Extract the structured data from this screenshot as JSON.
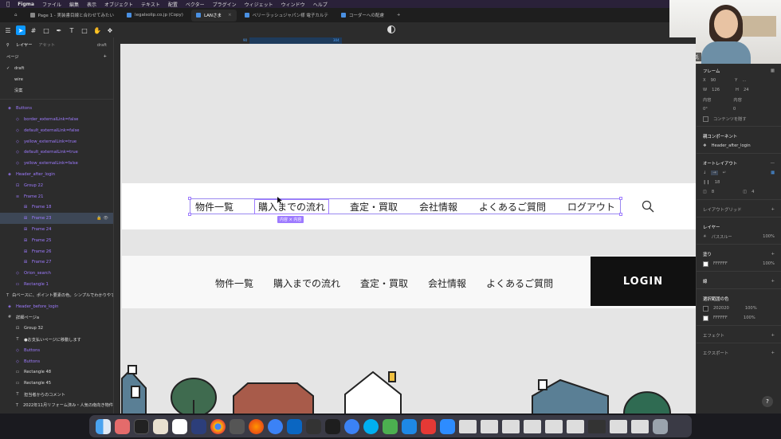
{
  "menubar": {
    "app_name": "Figma",
    "items": [
      "ファイル",
      "編集",
      "表示",
      "オブジェクト",
      "テキスト",
      "配置",
      "ベクター",
      "プラグイン",
      "ウィジェット",
      "ウィンドウ",
      "ヘルプ"
    ]
  },
  "tabs": [
    {
      "label": "Page 1 - 実装書目線と合わせてみたい"
    },
    {
      "label": "legalsolip.co.jp (Copy)"
    },
    {
      "label": "LANさま",
      "active": true
    },
    {
      "label": "ベリーラッシュジャパン様 電子カルテ"
    },
    {
      "label": "コーダーへの配慮"
    }
  ],
  "video": {
    "participant_name": "庄司 美雪氏"
  },
  "left_panel": {
    "tab_layers": "レイヤー",
    "tab_assets": "アセット",
    "page_label": "draft",
    "pages_title": "ページ",
    "pages": [
      {
        "label": "draft",
        "current": true
      },
      {
        "label": "wire"
      },
      {
        "label": "没案"
      }
    ],
    "layers": [
      {
        "label": "Buttons",
        "kind": "comp",
        "glyph": "◈",
        "indent": 0
      },
      {
        "label": "border_externalLink=false",
        "kind": "comp",
        "glyph": "◇",
        "indent": 1
      },
      {
        "label": "default_externalLink=false",
        "kind": "comp",
        "glyph": "◇",
        "indent": 1
      },
      {
        "label": "yellow_externalLink=true",
        "kind": "comp",
        "glyph": "◇",
        "indent": 1
      },
      {
        "label": "default_externalLink=true",
        "kind": "comp",
        "glyph": "◇",
        "indent": 1
      },
      {
        "label": "yellow_externalLink=false",
        "kind": "comp",
        "glyph": "◇",
        "indent": 1
      },
      {
        "label": "Header_after_login",
        "kind": "comp",
        "glyph": "◈",
        "indent": 0
      },
      {
        "label": "Group 22",
        "kind": "comp",
        "glyph": "⊡",
        "indent": 1
      },
      {
        "label": "Frame 21",
        "kind": "comp",
        "glyph": "≡",
        "indent": 1
      },
      {
        "label": "Frame 18",
        "kind": "comp",
        "glyph": "⊞",
        "indent": 2
      },
      {
        "label": "Frame 23",
        "kind": "comp",
        "glyph": "⊞",
        "indent": 2,
        "selected": true
      },
      {
        "label": "Frame 24",
        "kind": "comp",
        "glyph": "⊞",
        "indent": 2
      },
      {
        "label": "Frame 25",
        "kind": "comp",
        "glyph": "⊞",
        "indent": 2
      },
      {
        "label": "Frame 26",
        "kind": "comp",
        "glyph": "⊞",
        "indent": 2
      },
      {
        "label": "Frame 27",
        "kind": "comp",
        "glyph": "⊞",
        "indent": 2
      },
      {
        "label": "Orion_search",
        "kind": "comp",
        "glyph": "◇",
        "indent": 1
      },
      {
        "label": "Rectangle 1",
        "kind": "comp",
        "glyph": "▭",
        "indent": 1
      },
      {
        "label": "白ベースに、ポイント要素の色。シンプルでわかりやす",
        "kind": "text",
        "glyph": "T",
        "indent": 0
      },
      {
        "label": "Header_before_login",
        "kind": "comp",
        "glyph": "◈",
        "indent": 0
      },
      {
        "label": "詳細ページa",
        "kind": "frame",
        "glyph": "#",
        "indent": 0
      },
      {
        "label": "Group 32",
        "kind": "frame",
        "glyph": "⊡",
        "indent": 1
      },
      {
        "label": "●お支払いページに移動します",
        "kind": "text",
        "glyph": "T",
        "indent": 1
      },
      {
        "label": "Buttons",
        "kind": "comp",
        "glyph": "◇",
        "indent": 1
      },
      {
        "label": "Buttons",
        "kind": "comp",
        "glyph": "◇",
        "indent": 1
      },
      {
        "label": "Rectangle 48",
        "kind": "frame",
        "glyph": "▭",
        "indent": 1
      },
      {
        "label": "Rectangle 45",
        "kind": "frame",
        "glyph": "▭",
        "indent": 1
      },
      {
        "label": "担当者からのコメント",
        "kind": "text",
        "glyph": "T",
        "indent": 1
      },
      {
        "label": "2022年11月リフォーム済み・人気の南向き物件",
        "kind": "text",
        "glyph": "T",
        "indent": 1
      }
    ]
  },
  "canvas": {
    "ruler_marks": [
      "90",
      "304"
    ],
    "nav_after_login": [
      "物件一覧",
      "購入までの流れ",
      "査定・買取",
      "会社情報",
      "よくあるご質問",
      "ログアウト"
    ],
    "selected_nav_index": 1,
    "selection_badge": "内容 × 内容",
    "nav_before_login": [
      "物件一覧",
      "購入までの流れ",
      "査定・買取",
      "会社情報",
      "よくあるご質問"
    ],
    "login_button": "LOGIN"
  },
  "right_panel": {
    "frame_title": "フレーム",
    "x_label": "X",
    "x_val": "90",
    "y_label": "Y",
    "y_val": "...",
    "w_label": "W",
    "w_val": "126",
    "h_label": "H",
    "h_val": "24",
    "hug_w": "内容",
    "hug_h": "内容",
    "rotation": "0°",
    "radius": "0",
    "clip_label": "コンテンツを隠す",
    "main_component_title": "親コンポーネント",
    "main_component_name": "Header_after_login",
    "autolayout_title": "オートレイアウト",
    "autolayout_gap": "18",
    "autolayout_padding_h": "8",
    "autolayout_padding_v": "4",
    "layout_grid_title": "レイアウトグリッド",
    "layer_title": "レイヤー",
    "layer_mode": "パススルー",
    "layer_opacity": "100%",
    "fill_title": "塗り",
    "fill_hex": "FFFFFF",
    "fill_opacity": "100%",
    "stroke_title": "線",
    "selection_colors_title": "選択範囲の色",
    "selection_colors": [
      {
        "hex": "202020",
        "opacity": "100%",
        "color": "#202020"
      },
      {
        "hex": "FFFFFF",
        "opacity": "100%",
        "color": "#ffffff"
      }
    ],
    "effects_title": "エフェクト",
    "export_title": "エクスポート",
    "help": "?"
  }
}
